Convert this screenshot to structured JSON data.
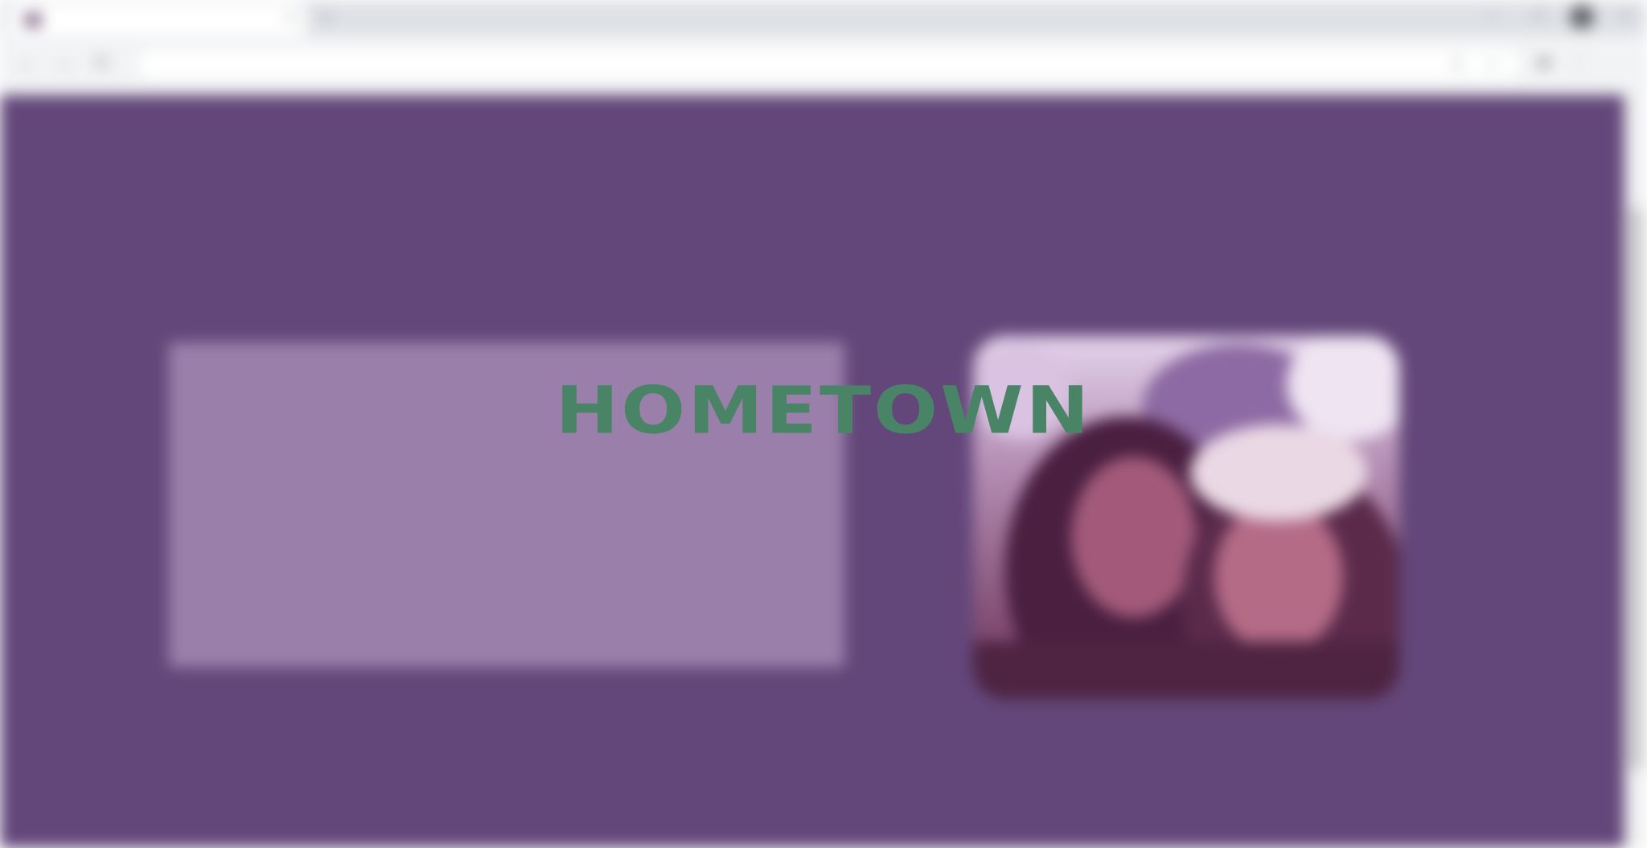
{
  "overlay": {
    "title": "HOMETOWN"
  },
  "page": {
    "background_color": "#63477a",
    "card_color": "#9b7fab",
    "overlay_color": "#4a8466"
  }
}
